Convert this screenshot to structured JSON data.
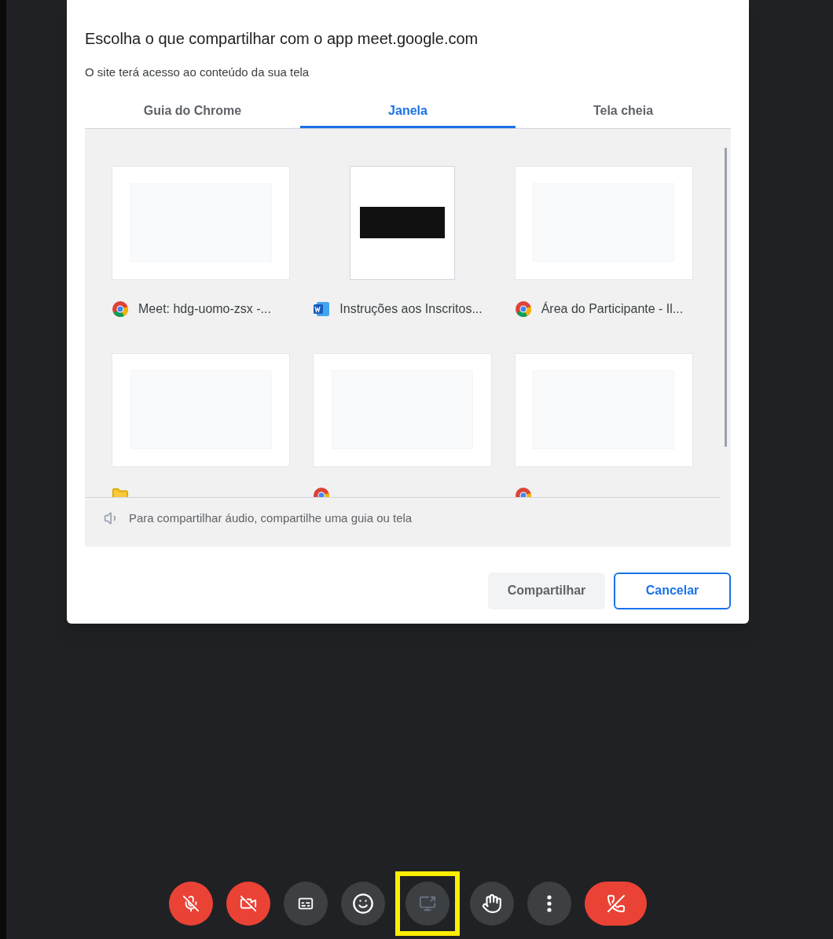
{
  "dialog": {
    "title": "Escolha o que compartilhar com o app meet.google.com",
    "subtitle": "O site terá acesso ao conteúdo da sua tela",
    "tabs": [
      {
        "label": "Guia do Chrome",
        "selected": false
      },
      {
        "label": "Janela",
        "selected": true
      },
      {
        "label": "Tela cheia",
        "selected": false
      }
    ],
    "windows": [
      {
        "kind": "chrome",
        "label": "Meet: hdg-uomo-zsx -..."
      },
      {
        "kind": "word",
        "label": "Instruções aos Inscritos..."
      },
      {
        "kind": "chrome",
        "label": "Área do Participante - Il..."
      },
      {
        "kind": "folder"
      },
      {
        "kind": "chrome"
      },
      {
        "kind": "chrome"
      }
    ],
    "audio_note": "Para compartilhar áudio, compartilhe uma guia ou tela",
    "buttons": [
      {
        "label": "Compartilhar",
        "kind": "primary",
        "disabled": true
      },
      {
        "label": "Cancelar",
        "kind": "secondary",
        "disabled": false
      }
    ]
  },
  "toolbar": [
    {
      "kind": "mic",
      "off": true,
      "highlighted": false
    },
    {
      "kind": "camera",
      "off": true,
      "highlighted": false
    },
    {
      "kind": "captions",
      "off": false,
      "highlighted": false
    },
    {
      "kind": "emoji",
      "off": false,
      "highlighted": false
    },
    {
      "kind": "present",
      "off": false,
      "highlighted": true
    },
    {
      "kind": "hand",
      "off": false,
      "highlighted": false
    },
    {
      "kind": "more",
      "off": false,
      "highlighted": false
    },
    {
      "kind": "hangup",
      "highlighted": false
    }
  ]
}
